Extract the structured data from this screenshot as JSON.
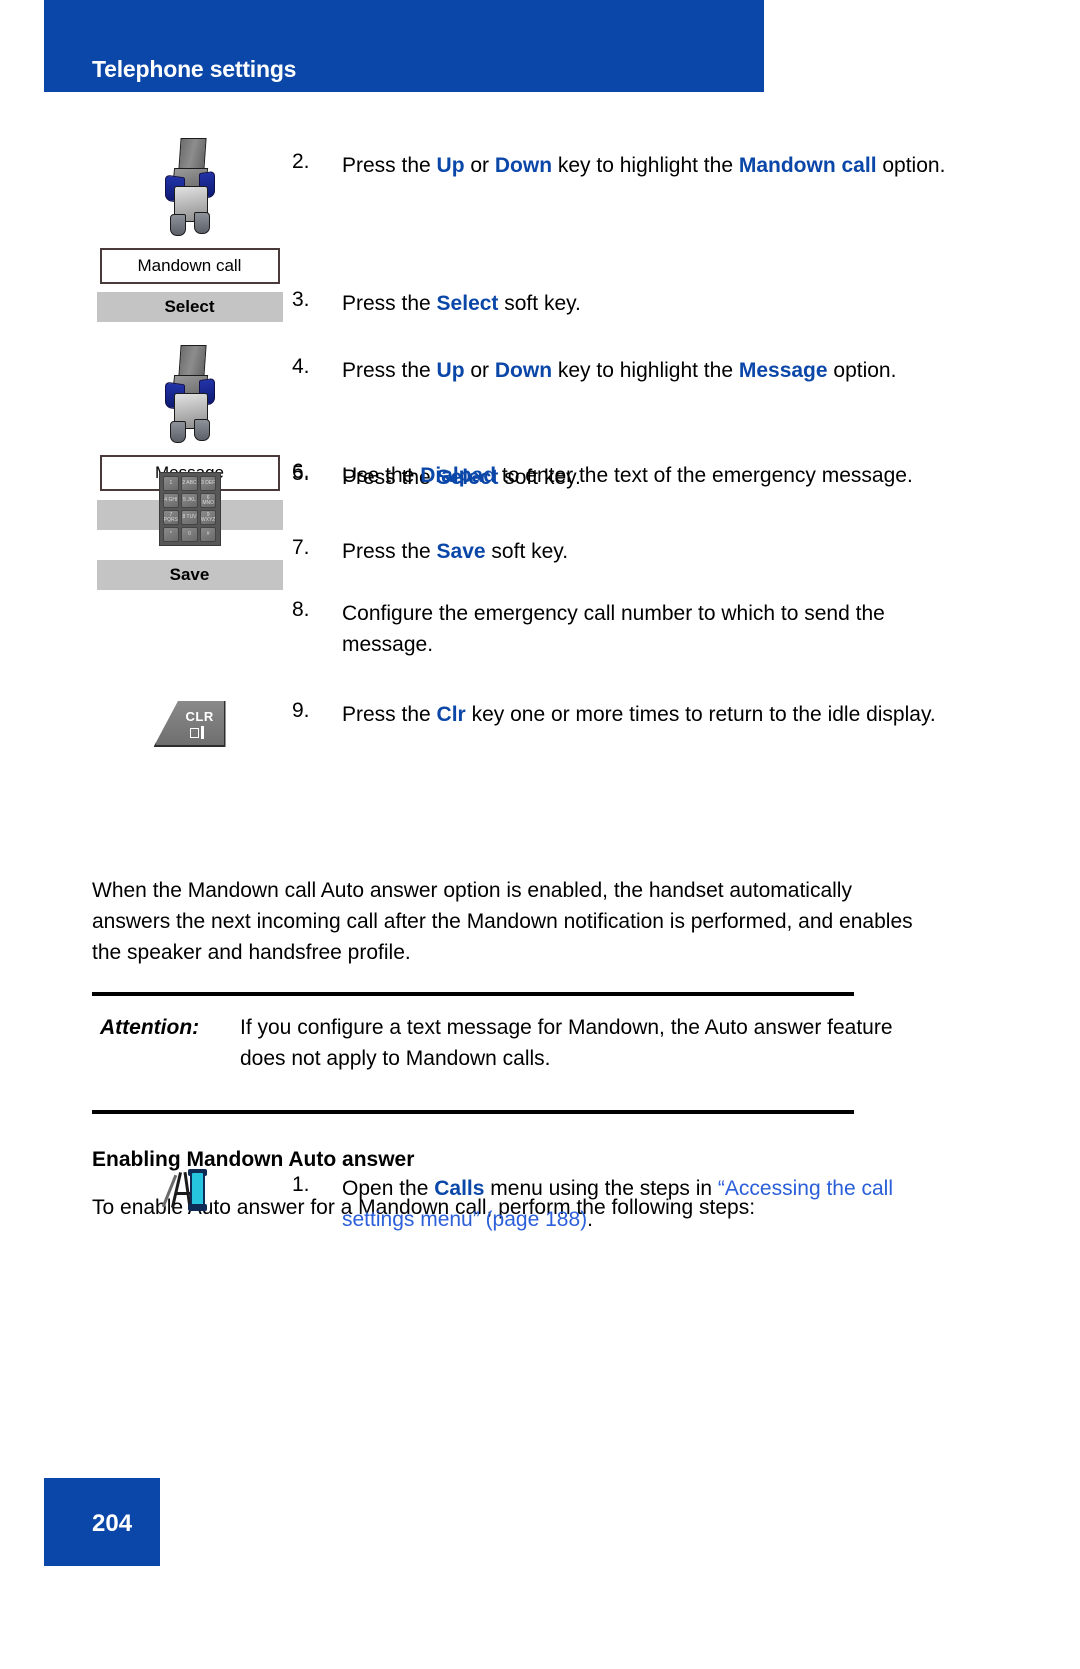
{
  "header": {
    "title": "Telephone settings"
  },
  "footer": {
    "page_number": "204"
  },
  "colors": {
    "brand_blue": "#0b47a8",
    "keyword_blue": "#0b47a8",
    "xref_blue": "#2b5fd9",
    "softkey_gray": "#c4c4c4"
  },
  "steps": {
    "s2": {
      "number": "2.",
      "pre": "Press the ",
      "kw1": "Up",
      "mid1": " or ",
      "kw2": "Down",
      "mid2": " key to highlight the ",
      "kw3": "Mandown call",
      "post": " option."
    },
    "s3": {
      "number": "3.",
      "pre": "Press the ",
      "kw1": "Select",
      "post": " soft key."
    },
    "s4": {
      "number": "4.",
      "pre": "Press the ",
      "kw1": "Up",
      "mid1": " or ",
      "kw2": "Down",
      "mid2": " key to highlight the ",
      "kw3": "Message",
      "post": " option."
    },
    "s5": {
      "number": "5.",
      "pre": "Press the ",
      "kw1": "Select",
      "post": " soft key."
    },
    "s6": {
      "number": "6.",
      "pre": "Use the ",
      "kw1": "Dialpad",
      "post": " to enter the text of the emergency message."
    },
    "s7": {
      "number": "7.",
      "pre": "Press the ",
      "kw1": "Save",
      "post": " soft key."
    },
    "s8": {
      "number": "8.",
      "text": "Configure the emergency call number to which to send the message."
    },
    "s9": {
      "number": "9.",
      "pre": "Press the ",
      "kw1": "Clr",
      "post": " key one or more times to return to the idle display."
    },
    "s1b": {
      "number": "1.",
      "pre": "Open the ",
      "kw1": "Calls",
      "mid1": " menu using the steps in ",
      "xref": "“Accessing the call settings menu” (page 188)",
      "post": "."
    }
  },
  "ui_elements": {
    "display_mandown_call": "Mandown call",
    "display_message": "Message",
    "softkey_select_1": "Select",
    "softkey_select_2": "Select",
    "softkey_save": "Save",
    "clr_key_label": "CLR"
  },
  "dialpad_keys": [
    "1",
    "2 ABC",
    "3 DEF",
    "4 GHI",
    "5 JKL",
    "6 MNO",
    "7 PQRS",
    "8 TUV",
    "9 WXYZ",
    "*",
    "0",
    "#"
  ],
  "body": {
    "paragraph_1": "When the Mandown call Auto answer option is enabled, the handset automatically answers the next incoming call after the Mandown notification is performed, and enables the speaker and handsfree profile.",
    "attention_label": "Attention:",
    "attention_text": "If you configure a text message for Mandown, the Auto answer feature does not apply to Mandown calls.",
    "section_heading": "Enabling Mandown Auto answer",
    "paragraph_2": "To enable Auto answer for a Mandown call, perform the following steps:"
  }
}
